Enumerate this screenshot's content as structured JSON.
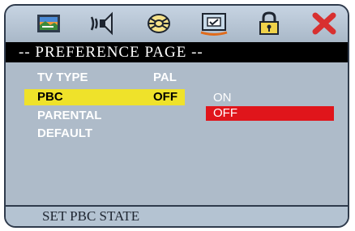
{
  "toolbar": {
    "icons": [
      "general-setup-icon",
      "audio-setup-icon",
      "video-setup-icon",
      "preference-page-icon",
      "password-setup-icon",
      "exit-icon"
    ],
    "active_index": 3
  },
  "page_title": "-- PREFERENCE PAGE --",
  "menu": {
    "items": [
      {
        "label": "TV TYPE",
        "value": "PAL"
      },
      {
        "label": "PBC",
        "value": "OFF"
      },
      {
        "label": "PARENTAL",
        "value": ""
      },
      {
        "label": "DEFAULT",
        "value": ""
      }
    ],
    "selected": "PBC"
  },
  "submenu": {
    "options": [
      "ON",
      "OFF"
    ],
    "selected": "OFF"
  },
  "status_text": "SET PBC STATE",
  "colors": {
    "background": "#aebbc9",
    "title_bar": "#000000",
    "selection_yellow": "#efe22a",
    "selection_red": "#e0151b"
  }
}
